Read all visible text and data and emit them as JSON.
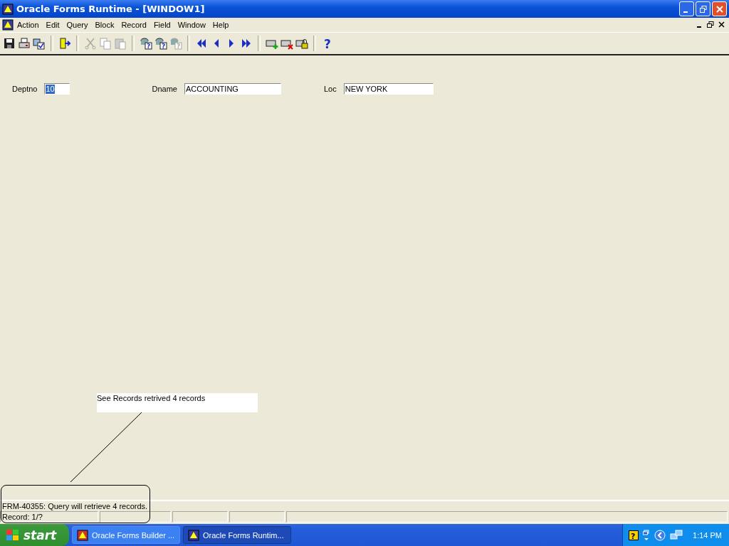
{
  "window": {
    "title": "Oracle Forms Runtime - [WINDOW1]"
  },
  "menu": [
    "Action",
    "Edit",
    "Query",
    "Block",
    "Record",
    "Field",
    "Window",
    "Help"
  ],
  "toolbar": [
    [
      {
        "kind": "save",
        "disabled": false
      },
      {
        "kind": "print",
        "disabled": false
      },
      {
        "kind": "check",
        "disabled": false
      }
    ],
    [
      {
        "kind": "exit",
        "disabled": false
      }
    ],
    [
      {
        "kind": "cut",
        "disabled": true
      },
      {
        "kind": "copy",
        "disabled": true
      },
      {
        "kind": "paste",
        "disabled": true
      }
    ],
    [
      {
        "kind": "query-enter",
        "disabled": false,
        "glyph": "?"
      },
      {
        "kind": "query-execute",
        "disabled": false,
        "glyph": "?"
      },
      {
        "kind": "query-cancel",
        "disabled": true,
        "glyph": "?"
      }
    ],
    [
      {
        "kind": "first",
        "disabled": false
      },
      {
        "kind": "prev",
        "disabled": false
      },
      {
        "kind": "next",
        "disabled": false
      },
      {
        "kind": "last",
        "disabled": false
      }
    ],
    [
      {
        "kind": "insert",
        "disabled": false
      },
      {
        "kind": "delete",
        "disabled": false
      },
      {
        "kind": "lock",
        "disabled": false
      }
    ],
    [
      {
        "kind": "help",
        "disabled": false,
        "glyph": "?"
      }
    ]
  ],
  "fields": [
    {
      "label": "Deptno",
      "value": "10",
      "text_selected": true
    },
    {
      "label": "Dname",
      "value": "ACCOUNTING",
      "text_selected": false
    },
    {
      "label": "Loc",
      "value": "NEW YORK",
      "text_selected": false
    }
  ],
  "annotation": {
    "text": "See Records retrived 4 records"
  },
  "status_bar": {
    "message": "FRM-40355: Query will retrieve 4 records.",
    "record": "Record: 1/?"
  },
  "taskbar": {
    "start": "start",
    "tasks": [
      {
        "label": "Oracle Forms Builder ...",
        "selected": false
      },
      {
        "label": "Oracle Forms Runtim...",
        "selected": true
      }
    ],
    "help_glyph": "?",
    "clock": "1:14 PM"
  }
}
